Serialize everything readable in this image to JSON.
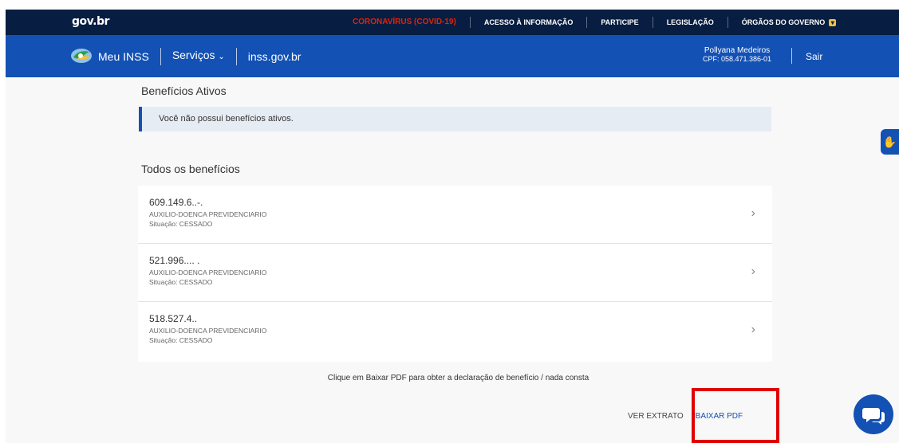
{
  "gov": {
    "logo": "gov.br",
    "links": [
      "CORONAVÍRUS (COVID-19)",
      "ACESSO À INFORMAÇÃO",
      "PARTICIPE",
      "LEGISLAÇÃO",
      "ÓRGÃOS DO GOVERNO"
    ]
  },
  "inss": {
    "title": "Meu INSS",
    "servicos": "Serviços",
    "site": "inss.gov.br",
    "user_name": "Pollyana Medeiros",
    "user_cpf": "CPF: 058.471.386-01",
    "logout": "Sair"
  },
  "active": {
    "title": "Benefícios Ativos",
    "notice": "Você não possui benefícios ativos."
  },
  "all": {
    "title": "Todos os benefícios",
    "items": [
      {
        "number": "609.149.6..-.",
        "type": "AUXILIO-DOENCA PREVIDENCIARIO",
        "status": "Situação: CESSADO"
      },
      {
        "number": "521.996.... .",
        "type": "AUXILIO-DOENCA PREVIDENCIARIO",
        "status": "Situação: CESSADO"
      },
      {
        "number": "518.527.4..",
        "type": "AUXILIO-DOENCA PREVIDENCIARIO",
        "status": "Situação: CESSADO"
      }
    ]
  },
  "hint": "Clique em Baixar PDF para obter a declaração de benefício / nada consta",
  "actions": {
    "extrato": "VER EXTRATO",
    "pdf": "BAIXAR PDF"
  },
  "colors": {
    "gov_bar": "#071d41",
    "inss_bar": "#1351b4",
    "covid": "#e52207",
    "highlight": "#e00000"
  }
}
